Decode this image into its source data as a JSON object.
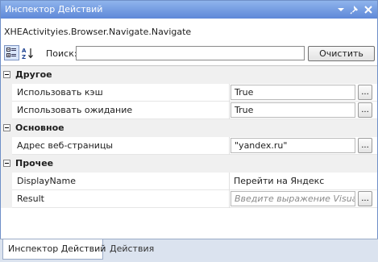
{
  "window": {
    "title": "Инспектор Действий"
  },
  "activity_name": "XHEActivityies.Browser.Navigate.Navigate",
  "toolbar": {
    "categorized_icon": "categorized-view-icon",
    "alphabetical_icon": "alphabetical-sort-icon",
    "search_label": "Поиск:",
    "search_value": "",
    "clear_label": "Очистить"
  },
  "grid": {
    "categories": [
      {
        "label": "Другое",
        "properties": [
          {
            "name": "Использовать кэш",
            "value": "True"
          },
          {
            "name": "Использовать ожидание",
            "value": "True"
          }
        ]
      },
      {
        "label": "Основное",
        "properties": [
          {
            "name": "Адрес веб-страницы",
            "value": "\"yandex.ru\""
          }
        ]
      },
      {
        "label": "Прочее",
        "properties": [
          {
            "name": "DisplayName",
            "value": "Перейти на Яндекс"
          },
          {
            "name": "Result",
            "placeholder": "Введите выражение Visual Basic"
          }
        ]
      }
    ],
    "ellipsis_label": "..."
  },
  "tabs": [
    {
      "label": "Инспектор Действий",
      "active": true
    },
    {
      "label": "Действия",
      "active": false
    }
  ],
  "colors": {
    "titlebar": "#6f96e0",
    "category_bg": "#f0f0f0",
    "tabstrip_bg": "#dbe3ef"
  }
}
